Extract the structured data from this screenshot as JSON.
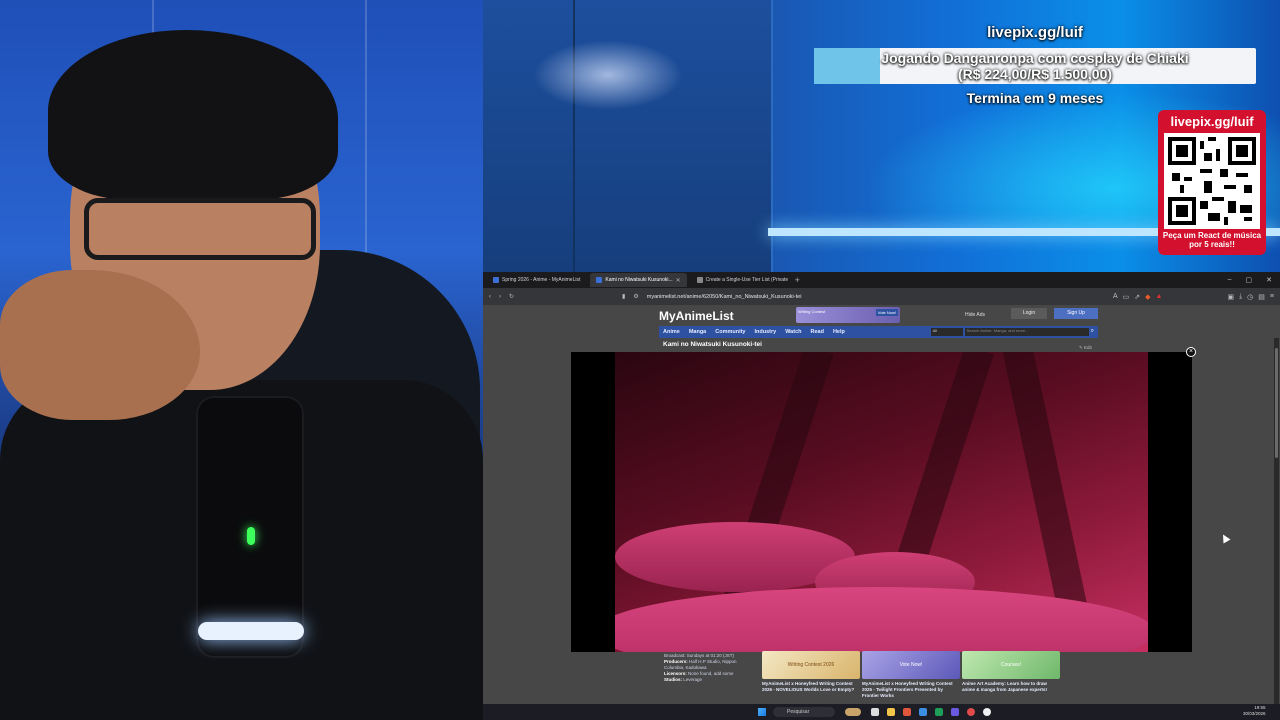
{
  "overlay": {
    "livepix_url": "livepix.gg/luif",
    "goal_text": "Jogando Danganronpa com cosplay de Chiaki",
    "goal_amount": "(R$ 224,00/R$ 1.500,00)",
    "goal_progress": 0.149,
    "goal_ends": "Termina em 9 meses",
    "qr_url": "livepix.gg/luif",
    "qr_caption": "Peça um React de música por 5 reais!!",
    "colors": {
      "qr_card": "#d3102d",
      "goal_fill": "#6fc4ea"
    }
  },
  "browser": {
    "tabs": [
      {
        "label": "Spring 2026 - Anime - MyAnimeList",
        "active": false
      },
      {
        "label": "Kami no Niwatsuki Kusunoki...",
        "active": true
      },
      {
        "label": "Create a Single-Use Tier List (Private",
        "active": false
      }
    ],
    "address": "myanimelist.net/anime/62050/Kami_no_Niwatsuki_Kusunoki-tei"
  },
  "mal": {
    "logo": "MyAnimeList",
    "banner_text": "Writing Contest",
    "banner_vote": "Vote Now!",
    "hide_ads": "Hide Ads",
    "login": "Login",
    "signup": "Sign Up",
    "nav": [
      "Anime",
      "Manga",
      "Community",
      "Industry",
      "Watch",
      "Read",
      "Help"
    ],
    "search_category": "All",
    "search_placeholder": "Search Anime, Manga, and more...",
    "title": "Kami no Niwatsuki Kusunoki-tei",
    "edit": "Edit",
    "info": {
      "broadcast": "Broadcast: Sundays at 01:20 (JST)",
      "producers_label": "Producers:",
      "producers": "Half H.P Studio, Nippon Columbia, Kadokawa",
      "licensors_label": "Licensors:",
      "licensors": "None found, add some",
      "studios_label": "Studios:",
      "studios": "Leverage"
    },
    "promos": [
      {
        "title": "Writing Contest 2026",
        "caption": "MyAnimeList x Honeyfeed Writing Contest 2026 - NOVELIOUS Worlds Love or Empty?"
      },
      {
        "title": "Vote Now!",
        "caption": "MyAnimeList x Honeyfeed Writing Contest 2025 - Twilight Frontiers Presented by Frontier Works"
      },
      {
        "title": "Courses!",
        "caption": "Anime Art Academy: Learn how to draw anime & manga from Japanese experts!"
      }
    ]
  },
  "taskbar": {
    "search": "Pesquisar",
    "time": "19:55",
    "date": "30/03/2026"
  }
}
